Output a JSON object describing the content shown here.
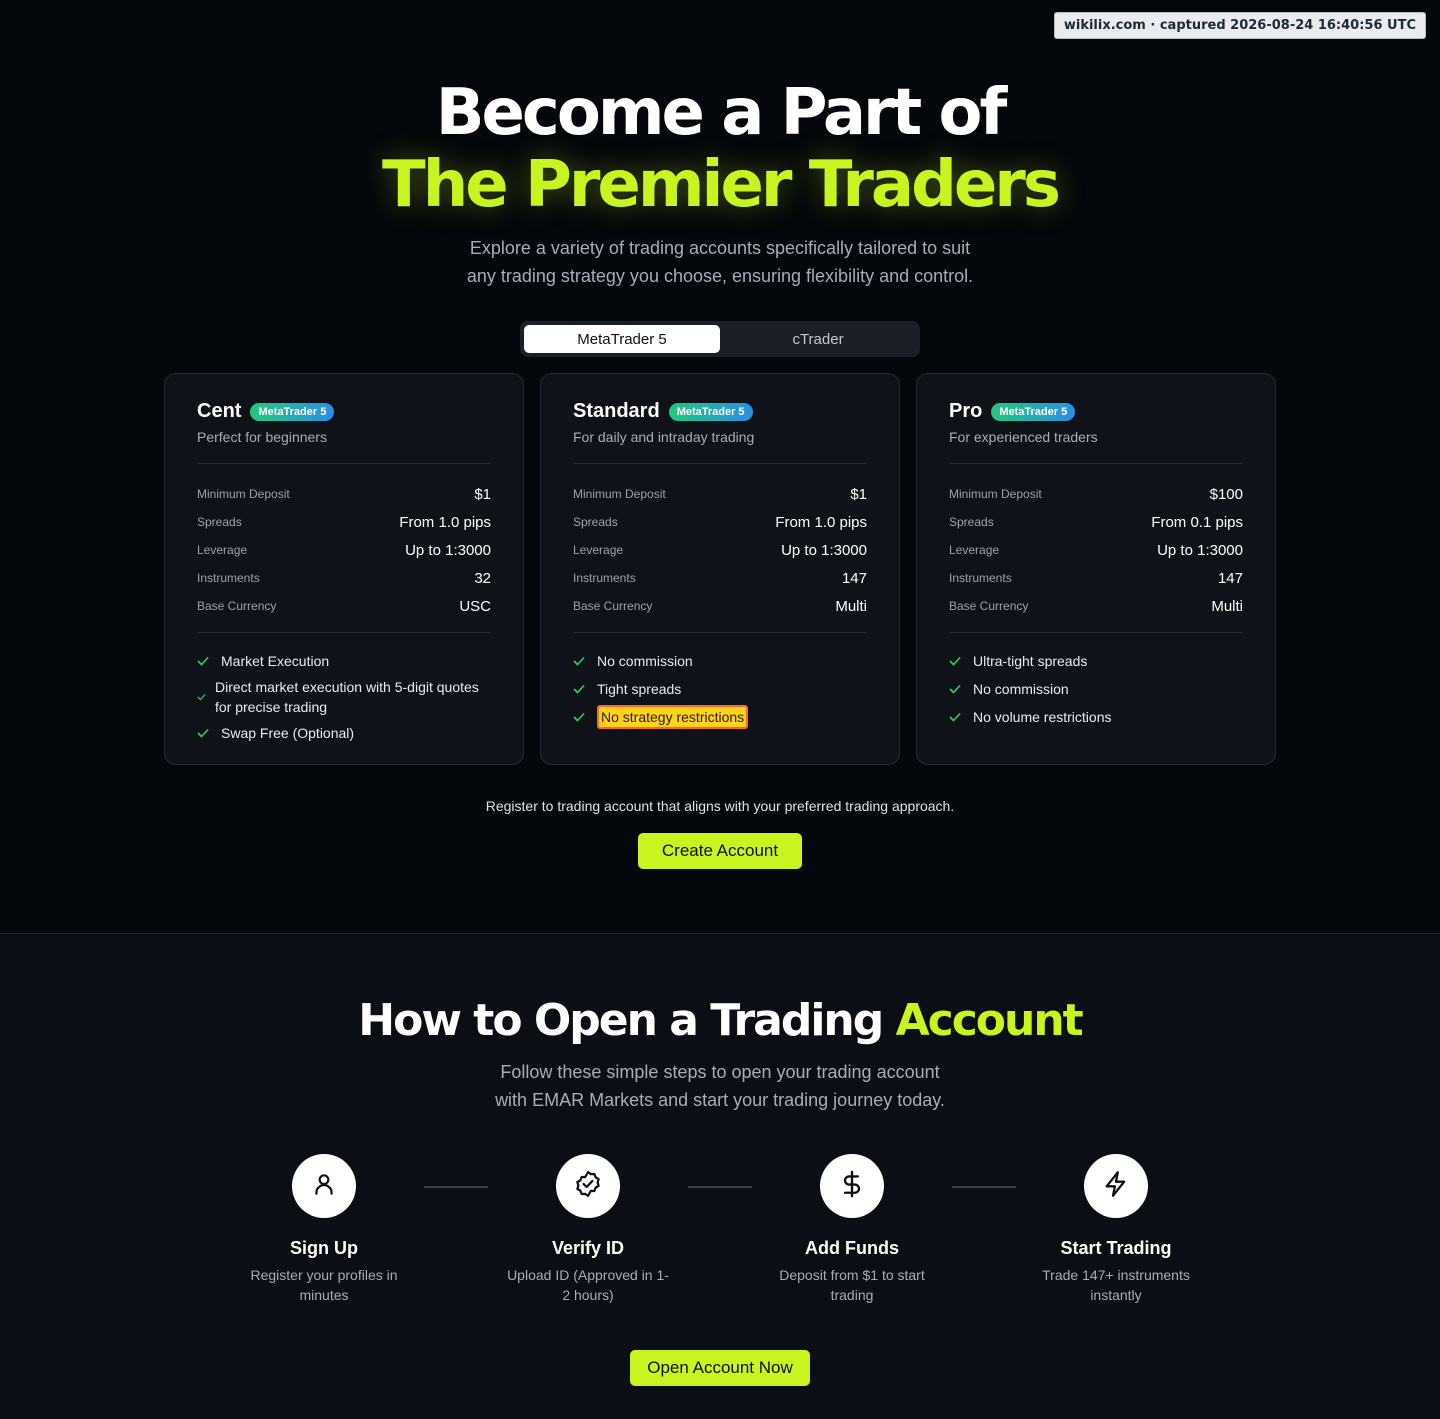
{
  "capture_stamp": "wikilix.com · captured 2026-08-24 16:40:56 UTC",
  "watermark_text": "wikilix.com",
  "hero": {
    "line1": "Become a Part of",
    "line2": "The Premier Traders",
    "subtitle_line1": "Explore a variety of trading accounts specifically tailored to suit",
    "subtitle_line2": "any trading strategy you choose, ensuring flexibility and control."
  },
  "platform_tabs": [
    {
      "label": "MetaTrader 5",
      "active": true
    },
    {
      "label": "cTrader",
      "active": false
    }
  ],
  "accounts": [
    {
      "name": "Cent",
      "badge": "MetaTrader 5",
      "subtitle": "Perfect for beginners",
      "specs": [
        {
          "label": "Minimum Deposit",
          "value": "$1"
        },
        {
          "label": "Spreads",
          "value": "From 1.0 pips"
        },
        {
          "label": "Leverage",
          "value": "Up to 1:3000"
        },
        {
          "label": "Instruments",
          "value": "32"
        },
        {
          "label": "Base Currency",
          "value": "USC"
        }
      ],
      "features": [
        "Market Execution",
        "Direct market execution with 5-digit quotes for precise trading",
        "Swap Free (Optional)"
      ]
    },
    {
      "name": "Standard",
      "badge": "MetaTrader 5",
      "subtitle": "For daily and intraday trading",
      "specs": [
        {
          "label": "Minimum Deposit",
          "value": "$1"
        },
        {
          "label": "Spreads",
          "value": "From 1.0 pips"
        },
        {
          "label": "Leverage",
          "value": "Up to 1:3000"
        },
        {
          "label": "Instruments",
          "value": "147"
        },
        {
          "label": "Base Currency",
          "value": "Multi"
        }
      ],
      "features": [
        "No commission",
        "Tight spreads",
        "No strategy restrictions"
      ]
    },
    {
      "name": "Pro",
      "badge": "MetaTrader 5",
      "subtitle": "For experienced traders",
      "specs": [
        {
          "label": "Minimum Deposit",
          "value": "$100"
        },
        {
          "label": "Spreads",
          "value": "From 0.1 pips"
        },
        {
          "label": "Leverage",
          "value": "Up to 1:3000"
        },
        {
          "label": "Instruments",
          "value": "147"
        },
        {
          "label": "Base Currency",
          "value": "Multi"
        }
      ],
      "features": [
        "Ultra-tight spreads",
        "No commission",
        "No volume restrictions"
      ]
    }
  ],
  "register_text": "Register to trading account that aligns with your preferred trading approach.",
  "create_account_label": "Create Account",
  "how_to": {
    "title_main": "How to Open a Trading ",
    "title_accent": "Account",
    "subtitle_line1": "Follow these simple steps to open your trading account",
    "subtitle_line2": "with EMAR Markets and start your trading journey today.",
    "steps": [
      {
        "icon": "user-icon",
        "title": "Sign Up",
        "desc": "Register your profiles in minutes"
      },
      {
        "icon": "verified-badge-icon",
        "title": "Verify ID",
        "desc": "Upload ID (Approved in 1-2 hours)"
      },
      {
        "icon": "dollar-icon",
        "title": "Add Funds",
        "desc": "Deposit from $1 to start trading"
      },
      {
        "icon": "lightning-icon",
        "title": "Start Trading",
        "desc": "Trade 147+ instruments instantly"
      }
    ],
    "cta_label": "Open Account Now"
  },
  "colors": {
    "accent": "#c8f520",
    "check": "#2fd26b",
    "highlight": "#ffd21f",
    "highlight_border": "#ff6a1a"
  }
}
